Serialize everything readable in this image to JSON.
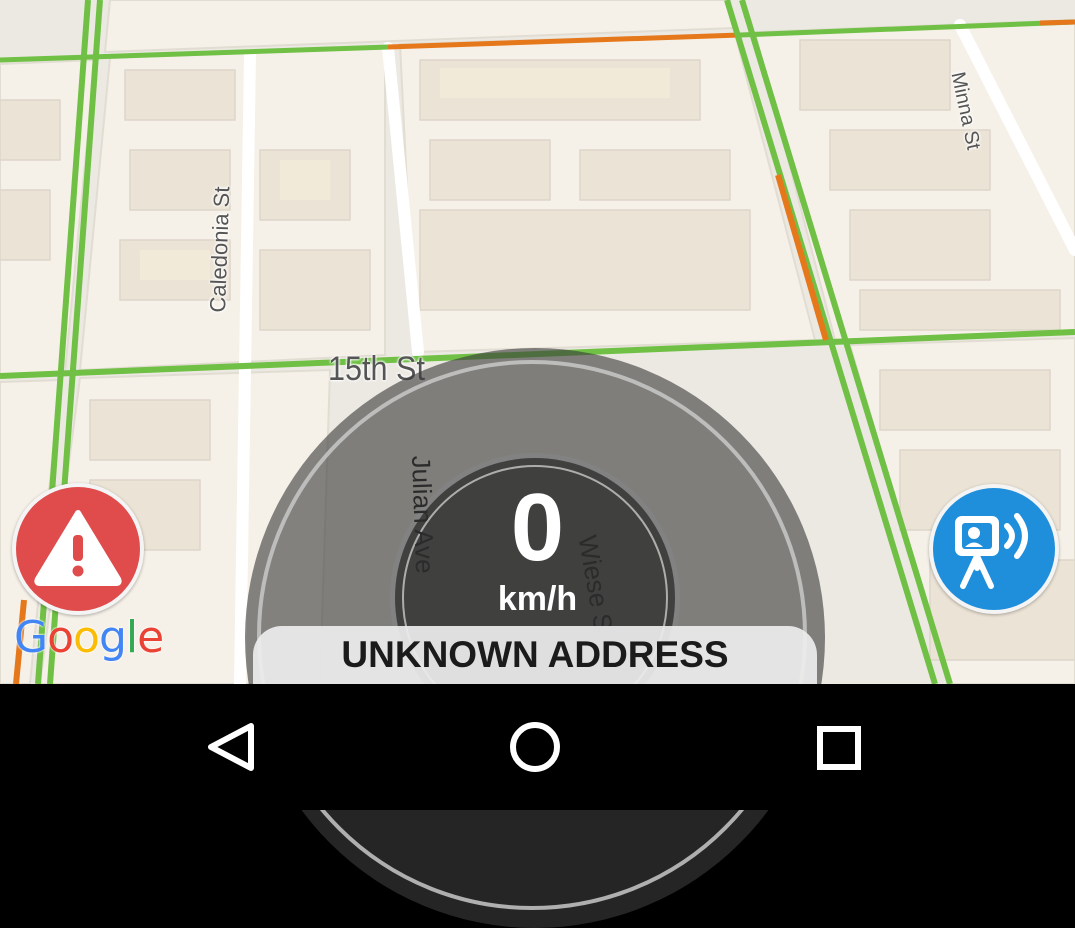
{
  "map": {
    "streets": {
      "fifteenth": "15th St",
      "caledonia": "Caledonia St",
      "minna": "Minna St",
      "julian": "Julian Ave",
      "wiese": "Wiese S"
    },
    "colors": {
      "traffic_green": "#6fc044",
      "traffic_orange": "#e6781c",
      "background": "#ece9e3",
      "building": "#f4efe6"
    }
  },
  "speedometer": {
    "speed": "0",
    "unit": "km/h",
    "address": "UNKNOWN ADDRESS"
  },
  "buttons": {
    "alert_icon": "warning-triangle-icon",
    "alert_color": "#e04c4c",
    "radar_icon": "speed-camera-icon",
    "radar_color": "#1f8fdc"
  },
  "attribution": {
    "logo": [
      "G",
      "o",
      "o",
      "g",
      "l",
      "e"
    ],
    "logo_colors": [
      "#4285f4",
      "#ea4335",
      "#fbbc05",
      "#4285f4",
      "#34a853",
      "#ea4335"
    ]
  },
  "navbar": {
    "back_icon": "back-triangle-icon",
    "home_icon": "home-circle-icon",
    "recents_icon": "recents-square-icon"
  }
}
